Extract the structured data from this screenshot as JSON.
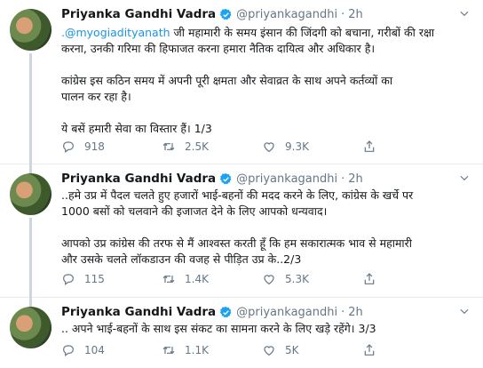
{
  "tweets": [
    {
      "name": "Priyanka Gandhi Vadra",
      "handle": "@priyankagandhi",
      "time": "2h",
      "mention": ".@myogiadityanath",
      "lines": [
        " जी महामारी के समय इंसान की जिंदगी को बचाना, गरीबों की रक्षा",
        "करना, उनकी गरिमा की हिफाजत करना हमारा नैतिक दायित्व और अधिकार है।",
        "कांग्रेस इस कठिन समय में अपनी पूरी क्षमता और सेवाव्रत के साथ अपने कर्तव्यों का",
        "पालन कर रहा है।",
        "ये बसें हमारी सेवा का विस्तार हैं। 1/3"
      ],
      "replies": "918",
      "retweets": "2.5K",
      "likes": "9.3K"
    },
    {
      "name": "Priyanka Gandhi Vadra",
      "handle": "@priyankagandhi",
      "time": "2h",
      "lines": [
        "..हमे उप्र में पैदल चलते हुए हजारों भाई-बहनों की मदद करने के लिए, कांग्रेस के खर्चे पर",
        "1000 बसों को चलवाने की इजाजत देने के लिए आपको धन्यवाद।",
        "आपको उप्र कांग्रेस की तरफ से मैं आश्वस्त करती हूँ कि हम सकारात्मक भाव से महामारी",
        "और उसके चलते लॉकडाउन की वजह से पीड़ित उप्र के..2/3"
      ],
      "replies": "115",
      "retweets": "1.4K",
      "likes": "5.3K"
    },
    {
      "name": "Priyanka Gandhi Vadra",
      "handle": "@priyankagandhi",
      "time": "2h",
      "lines": [
        ".. अपने भाई-बहनों के साथ इस संकट का सामना करने के लिए खड़े रहेंगे। 3/3"
      ],
      "replies": "104",
      "retweets": "1.1K",
      "likes": "5K"
    }
  ],
  "colors": {
    "verified": "#1da1f2",
    "mention": "#1b95e0",
    "meta": "#657786"
  }
}
